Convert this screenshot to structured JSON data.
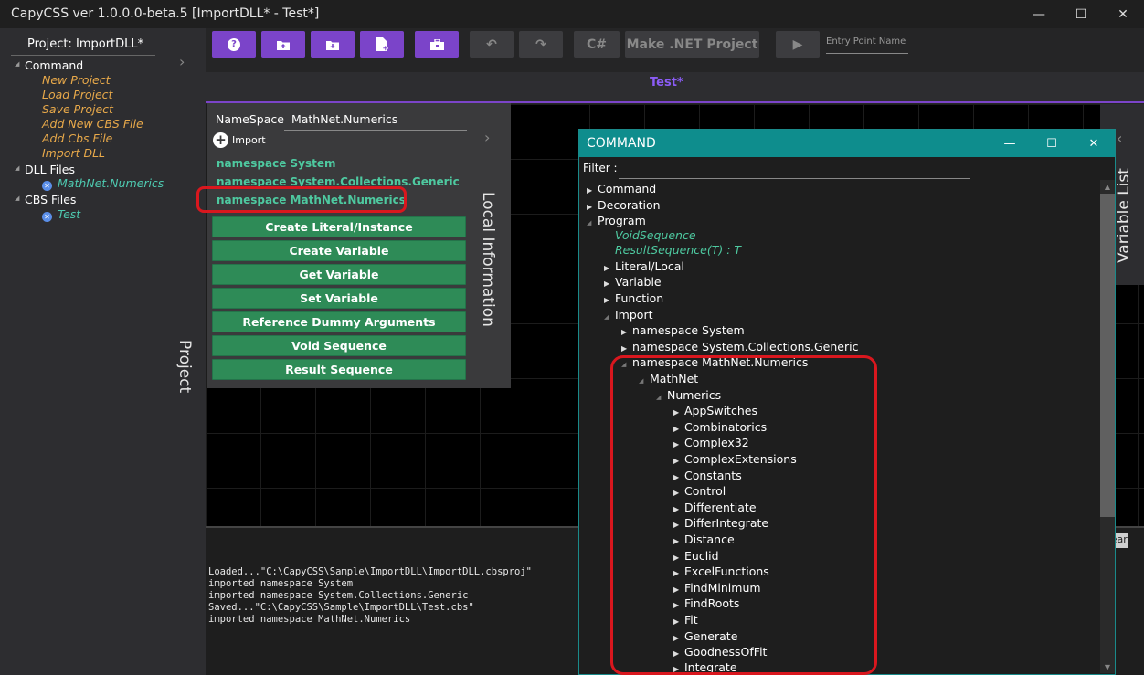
{
  "titlebar": {
    "title": "CapyCSS ver 1.0.0.0-beta.5 [ImportDLL* - Test*]",
    "minimize_icon": "—",
    "maximize_icon": "☐",
    "close_icon": "✕"
  },
  "project": {
    "header": "Project:  ImportDLL*",
    "vertical_label": "Project",
    "command_label": "Command",
    "commands": [
      "New Project",
      "Load Project",
      "Save Project",
      "Add New CBS File",
      "Add Cbs File",
      "Import DLL"
    ],
    "dll_label": "DLL Files",
    "dll_files": [
      "MathNet.Numerics"
    ],
    "cbs_label": "CBS Files",
    "cbs_files": [
      "Test"
    ]
  },
  "toolbar": {
    "help": "?",
    "csharp": "C#",
    "make_net": "Make .NET Project",
    "run": "▶",
    "entry_placeholder": "Entry Point Name"
  },
  "tab": {
    "label": "Test*"
  },
  "local_info": {
    "vertical_label": "Local Information",
    "namespace_label": "NameSpace",
    "namespace_value": "MathNet.Numerics",
    "import_label": "Import",
    "namespaces": [
      "namespace System",
      "namespace System.Collections.Generic",
      "namespace MathNet.Numerics"
    ],
    "buttons": [
      "Create Literal/Instance",
      "Create Variable",
      "Get Variable",
      "Set Variable",
      "Reference Dummy Arguments",
      "Void Sequence",
      "Result Sequence"
    ]
  },
  "variable_list": {
    "vertical_label": "Variable List",
    "clear_label": "Clear"
  },
  "log": [
    "Loaded...\"C:\\CapyCSS\\Sample\\ImportDLL\\ImportDLL.cbsproj\"",
    "imported namespace System",
    "imported namespace System.Collections.Generic",
    "Saved...\"C:\\CapyCSS\\Sample\\ImportDLL\\Test.cbs\"",
    "imported namespace MathNet.Numerics"
  ],
  "command_window": {
    "title": "COMMAND",
    "filter_label": "Filter :",
    "tree": {
      "command": "Command",
      "decoration": "Decoration",
      "program": "Program",
      "void_sequence": "VoidSequence",
      "result_sequence": "ResultSequence(T) : T",
      "literal_local": "Literal/Local",
      "variable": "Variable",
      "function": "Function",
      "import": "Import",
      "ns_system": "namespace System",
      "ns_generic": "namespace System.Collections.Generic",
      "ns_mathnet": "namespace MathNet.Numerics",
      "mathnet": "MathNet",
      "numerics": "Numerics",
      "numerics_children": [
        "AppSwitches",
        "Combinatorics",
        "Complex32",
        "ComplexExtensions",
        "Constants",
        "Control",
        "Differentiate",
        "DifferIntegrate",
        "Distance",
        "Euclid",
        "ExcelFunctions",
        "FindMinimum",
        "FindRoots",
        "Fit",
        "Generate",
        "GoodnessOfFit",
        "Integrate"
      ]
    }
  }
}
